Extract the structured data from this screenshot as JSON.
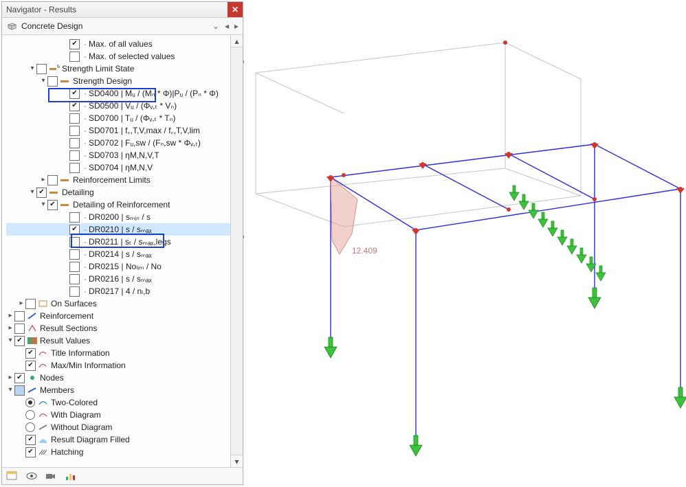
{
  "panel": {
    "title": "Navigator - Results",
    "section": "Concrete Design"
  },
  "tree": {
    "max_all": "Max. of all values",
    "max_sel": "Max. of selected values",
    "strength_limit_state": "Strength Limit State",
    "strength_design": "Strength Design",
    "sd0400": "SD0400 | Mᵤ / (Mₙ * Φ)|Pᵤ / (Pₙ * Φ)",
    "sd0500": "SD0500 | Vᵤ / (Φᵥ,ₜ * Vₙ)",
    "sd0700": "SD0700 | Tᵤ / (Φᵥ,ₜ * Tₙ)",
    "sd0701": "SD0701 | f꜀,T,V,max / f꜀,T,V,lim",
    "sd0702": "SD0702 | Fᵤ,sw / (Fₙ,sw * Φᵥ,ₜ)",
    "sd0703": "SD0703 | ηM,N,V,T",
    "sd0704": "SD0704 | ηM,N,V",
    "reinf_limits": "Reinforcement Limits",
    "detailing": "Detailing",
    "detailing_of_reinf": "Detailing of Reinforcement",
    "dr0200": "DR0200 | sₘᵢₙ / s",
    "dr0210": "DR0210 | s / sₘₐₓ",
    "dr0211": "DR0211 | sₜ / sₘₐₓ,legs",
    "dr0214": "DR0214 | s / sₘₐₓ",
    "dr0215": "DR0215 | Noₗᵢₘ / No",
    "dr0216": "DR0216 | s / sₘₐₓ",
    "dr0217": "DR0217 | 4 / nₗ,b",
    "on_surfaces": "On Surfaces",
    "reinforcement": "Reinforcement",
    "result_sections": "Result Sections",
    "result_values": "Result Values",
    "title_info": "Title Information",
    "maxmin_info": "Max/Min Information",
    "nodes": "Nodes",
    "members": "Members",
    "two_colored": "Two-Colored",
    "with_diagram": "With Diagram",
    "without_diagram": "Without Diagram",
    "result_diagram_filled": "Result Diagram Filled",
    "hatching": "Hatching"
  },
  "viewport": {
    "value_label": "12.409"
  },
  "colors": {
    "highlight": "#1a3fd4",
    "selection": "#cfe8ff",
    "close": "#c8382e"
  }
}
